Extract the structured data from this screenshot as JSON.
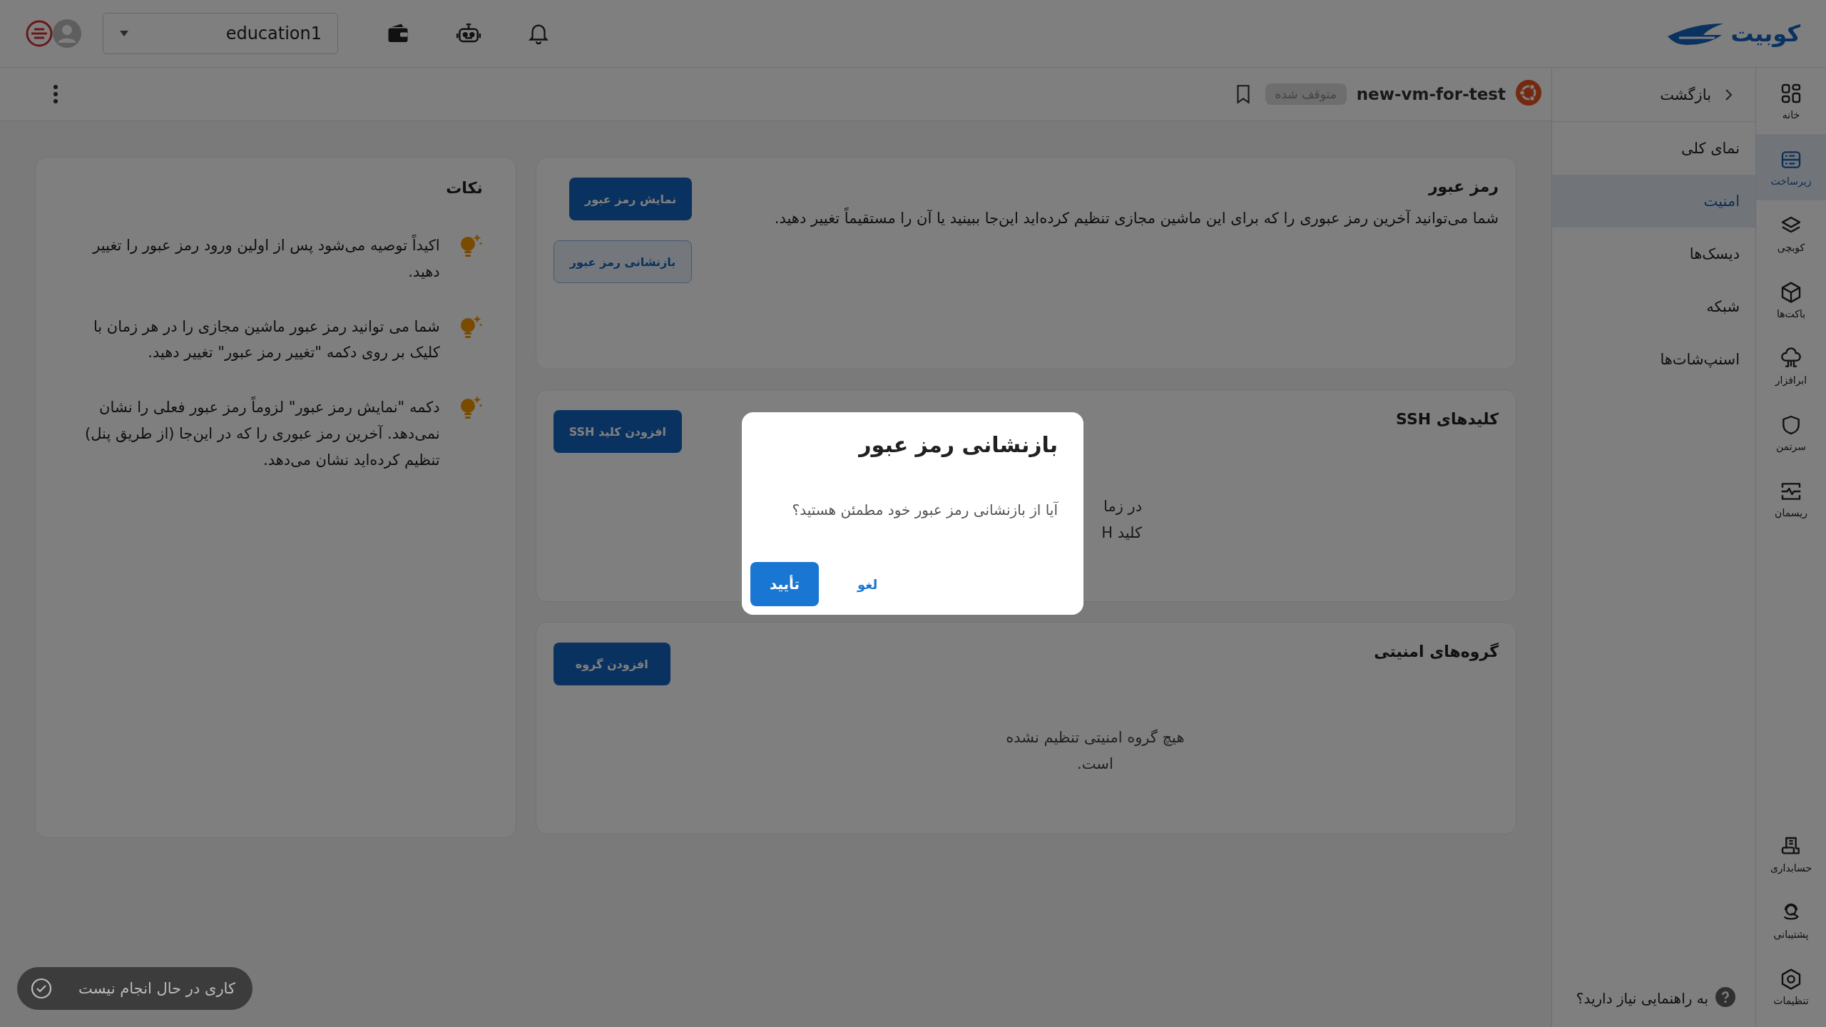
{
  "topbar": {
    "logo": "کوبیت",
    "account": "education1"
  },
  "vm_header": {
    "name": "new-vm-for-test",
    "status": "متوقف شده"
  },
  "rail": {
    "items": [
      {
        "label": "خانه",
        "selected": false
      },
      {
        "label": "زیرساخت",
        "selected": true
      },
      {
        "label": "کوبچی",
        "selected": false
      },
      {
        "label": "باکت‌ها",
        "selected": false
      },
      {
        "label": "ابرافزار",
        "selected": false
      },
      {
        "label": "سرتمن",
        "selected": false
      },
      {
        "label": "ریسمان",
        "selected": false
      }
    ],
    "bottom_items": [
      {
        "label": "حسابداری",
        "selected": false
      },
      {
        "label": "پشتیبانی",
        "selected": false
      },
      {
        "label": "تنظیمات",
        "selected": false
      }
    ]
  },
  "subnav": {
    "back": "بازگشت",
    "items": [
      {
        "label": "نمای کلی",
        "selected": false
      },
      {
        "label": "امنیت",
        "selected": true
      },
      {
        "label": "دیسک‌ها",
        "selected": false
      },
      {
        "label": "شبکه",
        "selected": false
      },
      {
        "label": "اسنپ‌شات‌ها",
        "selected": false
      }
    ],
    "help": "به راهنمایی نیاز دارید؟"
  },
  "cards": [
    {
      "kind": "password",
      "title": "رمز عبور",
      "text": "شما می‌توانید آخرین رمز عبوری را که برای این ماشین مجازی تنظیم کرده‌اید این‌جا ببینید یا آن را مستقیماً تغییر دهید.",
      "buttons": [
        {
          "label": "نمایش رمز عبور",
          "kind": "primary"
        },
        {
          "label": "بازنشانی رمز عبور",
          "kind": "outline"
        }
      ]
    },
    {
      "kind": "ssh",
      "title": "کلیدهای SSH",
      "lines": [
        "در زما",
        "کلید H"
      ],
      "buttons": [
        {
          "label": "افزودن کلید SSH",
          "kind": "primary"
        }
      ]
    },
    {
      "kind": "groups",
      "title": "گروه‌های امنیتی",
      "empty": "هیچ گروه امنیتی تنظیم نشده است.",
      "buttons": [
        {
          "label": "افزودن گروه",
          "kind": "primary"
        }
      ]
    }
  ],
  "notes": {
    "title": "نکات",
    "items": [
      "اکیداً توصیه می‌شود پس از اولین ورود رمز عبور را تغییر دهید.",
      "شما می توانید رمز عبور ماشین مجازی را در هر زمان با کلیک بر روی دکمه \"تغییر رمز عبور\" تغییر دهید.",
      "دکمه \"نمایش رمز عبور\" لزوماً رمز عبور فعلی را نشان نمی‌دهد. آخرین رمز عبوری را که در این‌جا (از طریق پنل) تنظیم کرده‌اید نشان می‌دهد."
    ]
  },
  "dialog": {
    "title": "بازنشانی رمز عبور",
    "message": "آیا از بازنشانی رمز عبور خود مطمئن هستید؟",
    "confirm": "تأیید",
    "cancel": "لغو"
  },
  "toast": "کاری در حال انجام نیست"
}
